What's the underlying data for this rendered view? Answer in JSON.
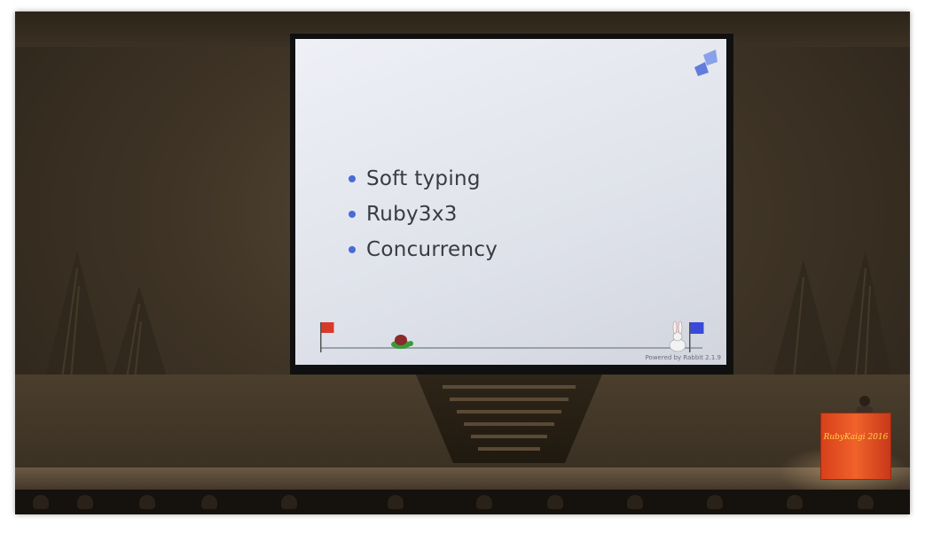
{
  "slide": {
    "bullets": [
      "Soft typing",
      "Ruby3x3",
      "Concurrency"
    ],
    "footer": "Powered by Rabbit 2.1.9",
    "accent_color": "#4a6ad8"
  },
  "podium": {
    "logo_text": "RubyKaigi 2016",
    "color": "#e8501f"
  }
}
